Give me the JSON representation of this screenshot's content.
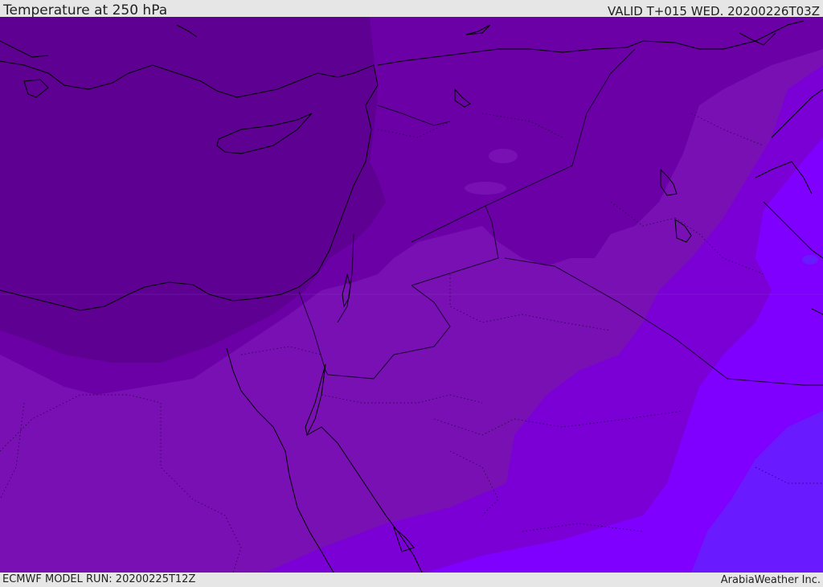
{
  "header": {
    "title": "Temperature at 250 hPa",
    "valid": "VALID T+015 WED. 20200226T03Z"
  },
  "footer": {
    "model_run": "ECMWF MODEL RUN: 20200225T12Z",
    "credit": "ArabiaWeather Inc."
  },
  "colors": {
    "coldest": "#5e0092",
    "cold": "#6a00a6",
    "cool": "#7810b4",
    "mild": "#7a00d6",
    "warm": "#8000ff",
    "warmest": "#6a1aff",
    "coastline": "#000000",
    "border": "#1a0030",
    "toolbar": "#e6e6e6"
  }
}
